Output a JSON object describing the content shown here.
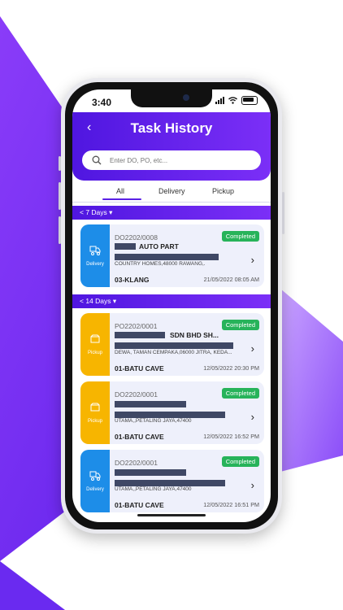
{
  "colors": {
    "accent": "#5a20e6",
    "delivery": "#1d8de8",
    "pickup": "#f7b500",
    "completed": "#27b35a"
  },
  "status_bar": {
    "time": "3:40"
  },
  "header": {
    "title": "Task History",
    "back_icon": "chevron-left-icon"
  },
  "search": {
    "placeholder": "Enter DO, PO, etc...",
    "icon": "search-icon"
  },
  "tabs": [
    {
      "label": "All",
      "selected": true
    },
    {
      "label": "Delivery"
    },
    {
      "label": "Pickup"
    }
  ],
  "sections": [
    {
      "label": "< 7 Days ▾"
    },
    {
      "label": "< 14 Days ▾"
    }
  ],
  "cards": [
    {
      "type": "Delivery",
      "code": "DO2202/0008",
      "status": "Completed",
      "company": "AUTO PART",
      "address": "COUNTRY HOMES,48000 RAWANG,.",
      "area": "03-KLANG",
      "datetime": "21/05/2022 08:05 AM"
    },
    {
      "type": "Pickup",
      "code": "PO2202/0001",
      "status": "Completed",
      "company": "SDN BHD SH...",
      "address": "DEWA, TAMAN CEMPAKA,06000 JITRA, KEDA...",
      "area": "01-BATU CAVE",
      "datetime": "12/05/2022 20:30 PM"
    },
    {
      "type": "Pickup",
      "code": "DO2202/0001",
      "status": "Completed",
      "company": "",
      "address": "UTAMA,,PETALING JAYA,47400",
      "area": "01-BATU CAVE",
      "datetime": "12/05/2022 16:52 PM"
    },
    {
      "type": "Delivery",
      "code": "DO2202/0001",
      "status": "Completed",
      "company": "",
      "address": "UTAMA,,PETALING JAYA,47400",
      "area": "01-BATU CAVE",
      "datetime": "12/05/2022 16:51 PM"
    }
  ]
}
